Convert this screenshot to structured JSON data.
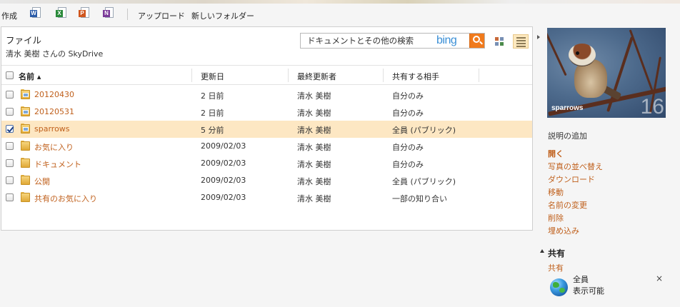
{
  "toolbar": {
    "create_label": "作成",
    "office_icons": [
      {
        "name": "word-icon",
        "letter": "W",
        "color": "#2b5ca8"
      },
      {
        "name": "excel-icon",
        "letter": "X",
        "color": "#2a8a3a"
      },
      {
        "name": "powerpoint-icon",
        "letter": "P",
        "color": "#d0561e"
      },
      {
        "name": "onenote-icon",
        "letter": "N",
        "color": "#7a3a98"
      }
    ],
    "upload_label": "アップロード",
    "new_folder_label": "新しいフォルダー"
  },
  "panel": {
    "title": "ファイル",
    "subtitle": "清水 美樹 さんの SkyDrive",
    "search": {
      "placeholder": "ドキュメントとその他の検索",
      "brand": "bing"
    }
  },
  "table": {
    "columns": [
      "名前 ▴",
      "更新日",
      "最終更新者",
      "共有する相手"
    ],
    "rows": [
      {
        "name": "20120430",
        "date": "2 日前",
        "by": "清水 美樹",
        "shared": "自分のみ",
        "checked": false,
        "has_image": true
      },
      {
        "name": "20120531",
        "date": "2 日前",
        "by": "清水 美樹",
        "shared": "自分のみ",
        "checked": false,
        "has_image": true
      },
      {
        "name": "sparrows",
        "date": "5 分前",
        "by": "清水 美樹",
        "shared": "全員 (パブリック)",
        "checked": true,
        "has_image": true
      },
      {
        "name": "お気に入り",
        "date": "2009/02/03",
        "by": "清水 美樹",
        "shared": "自分のみ",
        "checked": false,
        "has_image": false
      },
      {
        "name": "ドキュメント",
        "date": "2009/02/03",
        "by": "清水 美樹",
        "shared": "自分のみ",
        "checked": false,
        "has_image": false
      },
      {
        "name": "公開",
        "date": "2009/02/03",
        "by": "清水 美樹",
        "shared": "全員 (パブリック)",
        "checked": false,
        "has_image": false
      },
      {
        "name": "共有のお気に入り",
        "date": "2009/02/03",
        "by": "清水 美樹",
        "shared": "一部の知り合い",
        "checked": false,
        "has_image": false
      }
    ]
  },
  "preview": {
    "label": "sparrows",
    "count": "16"
  },
  "details": {
    "add_description": "説明の追加",
    "actions": [
      {
        "label": "開く",
        "bold": true
      },
      {
        "label": "写真の並べ替え",
        "bold": false
      },
      {
        "label": "ダウンロード",
        "bold": false
      },
      {
        "label": "移動",
        "bold": false
      },
      {
        "label": "名前の変更",
        "bold": false
      },
      {
        "label": "削除",
        "bold": false
      },
      {
        "label": "埋め込み",
        "bold": false
      }
    ]
  },
  "sharing": {
    "title": "共有",
    "share_link": "共有",
    "who": "全員",
    "visibility": "表示可能",
    "close_glyph": "×"
  },
  "colors": {
    "link": "#c0601c",
    "selected_row": "#fde7c3",
    "search_button": "#f07a1c"
  }
}
